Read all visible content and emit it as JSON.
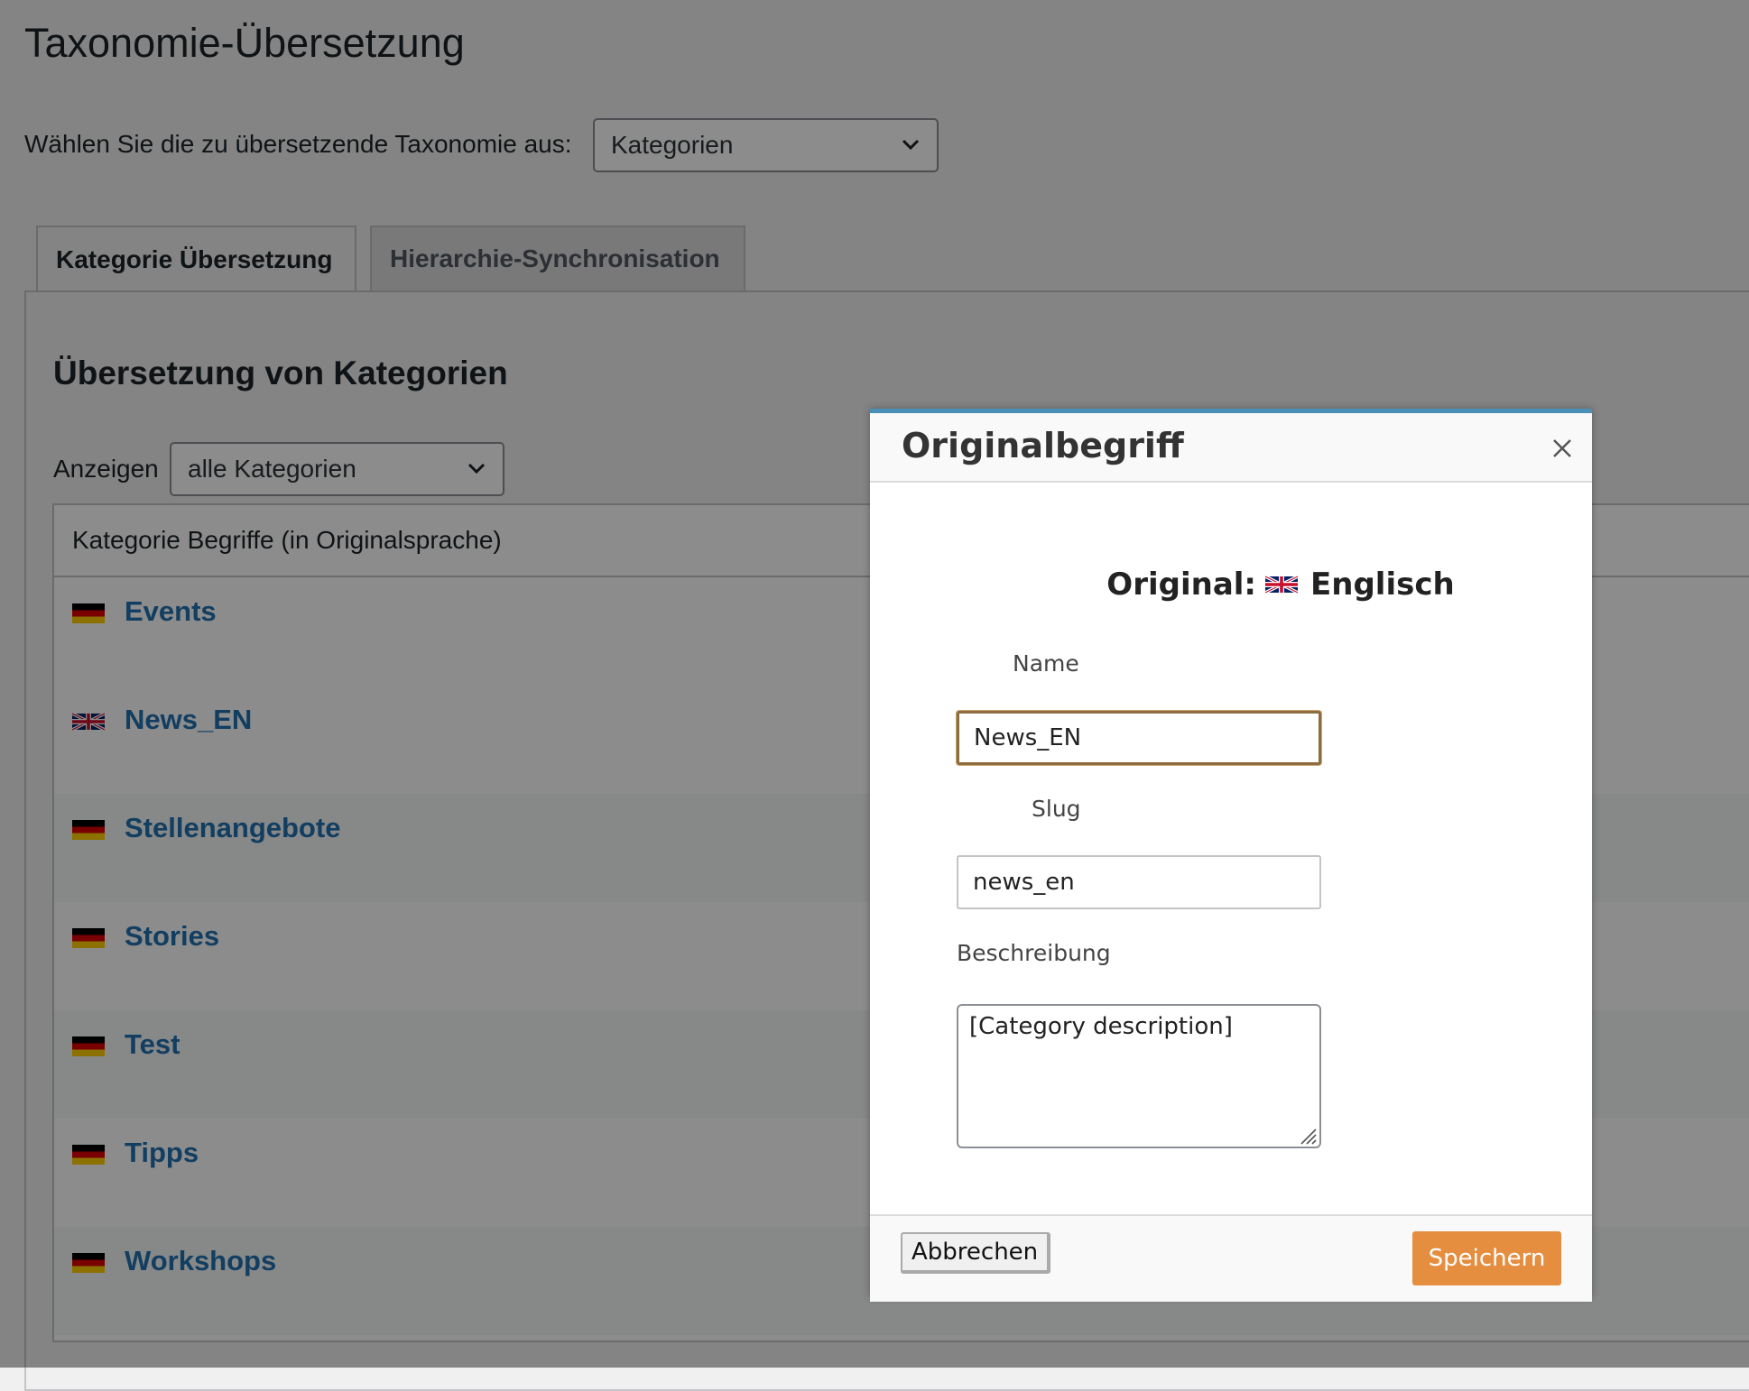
{
  "page": {
    "title": "Taxonomie-Übersetzung",
    "taxonomy_label": "Wählen Sie die zu übersetzende Taxonomie aus:",
    "taxonomy_selected": "Kategorien"
  },
  "tabs": [
    {
      "label": "Kategorie Übersetzung",
      "active": true
    },
    {
      "label": "Hierarchie-Synchronisation",
      "active": false
    }
  ],
  "section": {
    "title": "Übersetzung von Kategorien",
    "show_label": "Anzeigen",
    "show_selected": "alle Kategorien"
  },
  "table": {
    "header": "Kategorie Begriffe (in Originalsprache)",
    "rows": [
      {
        "term": "Events",
        "flag": "flag-de-icon"
      },
      {
        "term": "News_EN",
        "flag": "flag-uk-icon"
      },
      {
        "term": "Stellenangebote",
        "flag": "flag-de-icon"
      },
      {
        "term": "Stories",
        "flag": "flag-de-icon"
      },
      {
        "term": "Test",
        "flag": "flag-de-icon"
      },
      {
        "term": "Tipps",
        "flag": "flag-de-icon"
      },
      {
        "term": "Workshops",
        "flag": "flag-de-icon"
      }
    ]
  },
  "modal": {
    "title": "Originalbegriff",
    "original_prefix": "Original:",
    "original_language": "Englisch",
    "name_label": "Name",
    "name_value": "News_EN",
    "slug_label": "Slug",
    "slug_value": "news_en",
    "description_label": "Beschreibung",
    "description_value": "[Category description]",
    "cancel_label": "Abbrechen",
    "save_label": "Speichern"
  },
  "colors": {
    "accent_link": "#2271b1",
    "save_button": "#e58e3f",
    "modal_top_border": "#4a8fb5"
  }
}
